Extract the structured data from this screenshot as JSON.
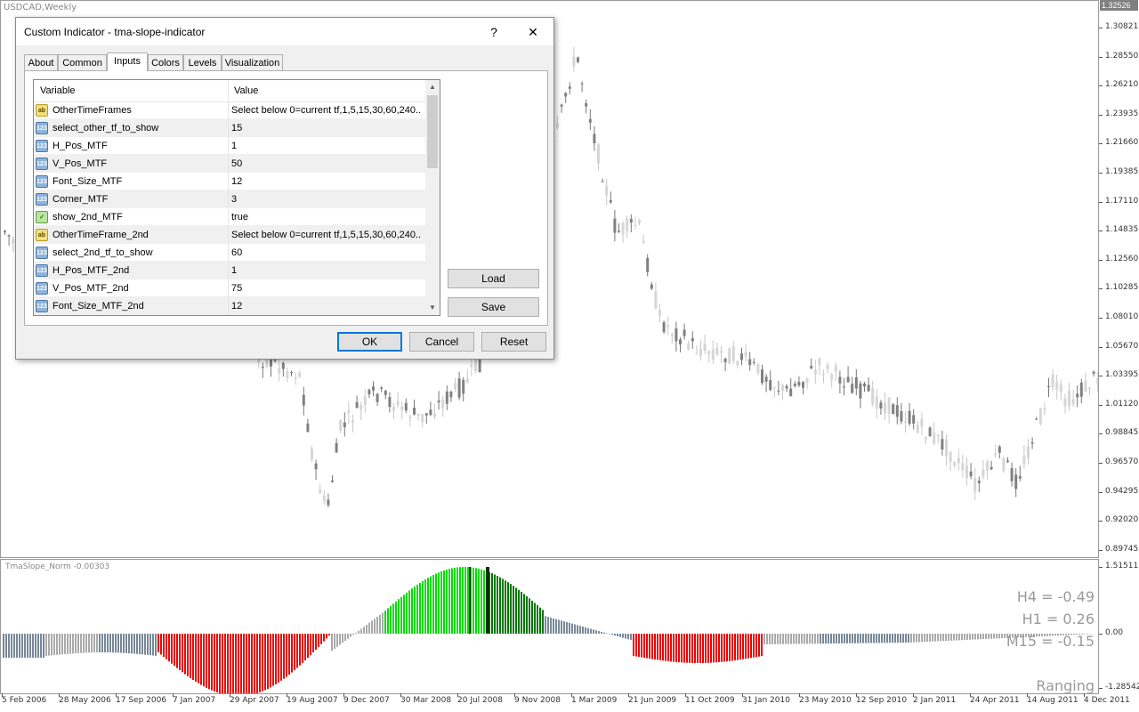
{
  "chart": {
    "symbol_title": "USDCAD,Weekly",
    "current_price": "1.32526",
    "price_ticks": [
      "1.30821",
      "1.28550",
      "1.26210",
      "1.23935",
      "1.21660",
      "1.19385",
      "1.17110",
      "1.14835",
      "1.12560",
      "1.10285",
      "1.08010",
      "1.05670",
      "1.03395",
      "1.01120",
      "0.98845",
      "0.96570",
      "0.94295",
      "0.92020",
      "0.89745"
    ],
    "indicator_ticks": [
      "1.51511",
      "0.00",
      "-1.28542"
    ],
    "time_ticks": [
      "5 Feb 2006",
      "28 May 2006",
      "17 Sep 2006",
      "7 Jan 2007",
      "29 Apr 2007",
      "19 Aug 2007",
      "9 Dec 2007",
      "30 Mar 2008",
      "20 Jul 2008",
      "9 Nov 2008",
      "1 Mar 2009",
      "21 Jun 2009",
      "11 Oct 2009",
      "31 Jan 2010",
      "23 May 2010",
      "12 Sep 2010",
      "2 Jan 2011",
      "24 Apr 2011",
      "14 Aug 2011",
      "4 Dec 2011"
    ],
    "indicator_title": "TmaSlope_Norm -0.00303",
    "tf_labels": {
      "h4": "H4 = -0.49",
      "h1": "H1 = 0.26",
      "m15": "M15 = -0.15"
    },
    "ranging_label": "Ranging",
    "colors": {
      "up_strong": "#00dd00",
      "up_dark": "#007700",
      "down": "#ee0000",
      "neutral_a": "#778899",
      "neutral_b": "#aaaaaa",
      "candle": "#777777"
    }
  },
  "dialog": {
    "title": "Custom Indicator - tma-slope-indicator",
    "help_label": "?",
    "close_label": "✕",
    "tabs": [
      "About",
      "Common",
      "Inputs",
      "Colors",
      "Levels",
      "Visualization"
    ],
    "active_tab": "Inputs",
    "grid": {
      "headers": {
        "variable": "Variable",
        "value": "Value"
      },
      "rows": [
        {
          "type": "str",
          "icon": "ab",
          "variable": "OtherTimeFrames",
          "value": "Select below 0=current tf,1,5,15,30,60,240..."
        },
        {
          "type": "num",
          "icon": "123",
          "variable": "select_other_tf_to_show",
          "value": "15"
        },
        {
          "type": "num",
          "icon": "123",
          "variable": "H_Pos_MTF",
          "value": "1"
        },
        {
          "type": "num",
          "icon": "123",
          "variable": "V_Pos_MTF",
          "value": "50"
        },
        {
          "type": "num",
          "icon": "123",
          "variable": "Font_Size_MTF",
          "value": "12"
        },
        {
          "type": "num",
          "icon": "123",
          "variable": "Corner_MTF",
          "value": "3"
        },
        {
          "type": "bool",
          "icon": "✓",
          "variable": "show_2nd_MTF",
          "value": "true"
        },
        {
          "type": "str",
          "icon": "ab",
          "variable": "OtherTimeFrame_2nd",
          "value": "Select below 0=current tf,1,5,15,30,60,240..."
        },
        {
          "type": "num",
          "icon": "123",
          "variable": "select_2nd_tf_to_show",
          "value": "60"
        },
        {
          "type": "num",
          "icon": "123",
          "variable": "H_Pos_MTF_2nd",
          "value": "1"
        },
        {
          "type": "num",
          "icon": "123",
          "variable": "V_Pos_MTF_2nd",
          "value": "75"
        },
        {
          "type": "num",
          "icon": "123",
          "variable": "Font_Size_MTF_2nd",
          "value": "12"
        }
      ]
    },
    "buttons": {
      "load": "Load",
      "save": "Save",
      "ok": "OK",
      "cancel": "Cancel",
      "reset": "Reset"
    }
  }
}
